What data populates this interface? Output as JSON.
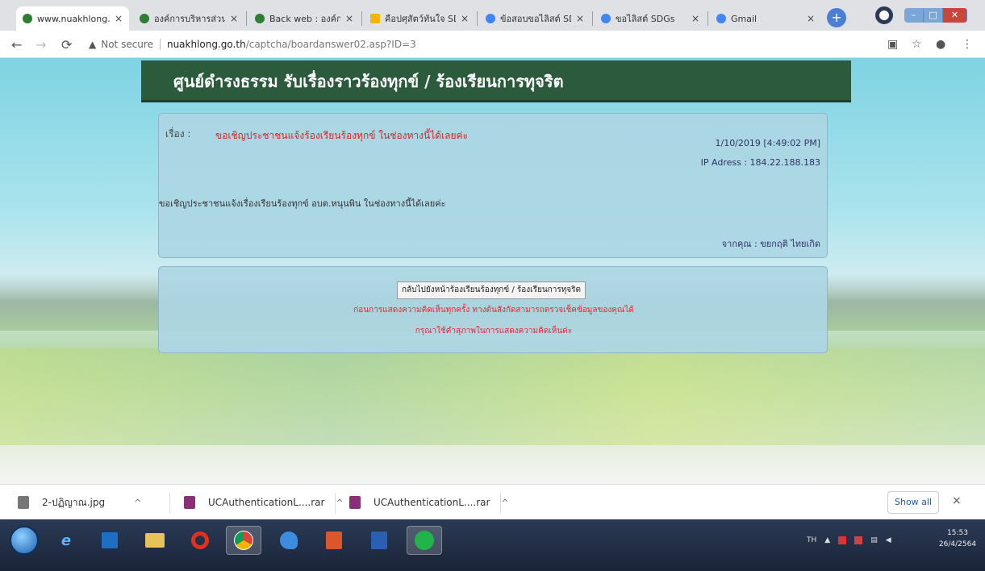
{
  "browser": {
    "tabs": [
      {
        "label": "www.nuakhlong.go",
        "color": "#2e7d32",
        "active": true
      },
      {
        "label": "องค์การบริหารส่วนต",
        "color": "#2e7d32",
        "active": false
      },
      {
        "label": "Back web : องค์การ",
        "color": "#2e7d32",
        "active": false
      },
      {
        "label": "คือปศุสัตว์ทันใจ SDGs",
        "color": "#f4b400",
        "active": false
      },
      {
        "label": "ข้อสอบขอไลิสต์ SDGs",
        "color": "#4285f4",
        "active": false
      },
      {
        "label": "ขอไลิสต์ SDGs",
        "color": "#4285f4",
        "active": false
      },
      {
        "label": "Gmail",
        "color": "#4285f4",
        "active": false
      }
    ],
    "tab_close": "×",
    "new_tab": "+",
    "address": {
      "security": "Not secure",
      "host": "nuakhlong.go.th",
      "path": "/captcha/boardanswer02.asp?ID=3"
    }
  },
  "page": {
    "banner_title": "ศูนย์ดำรงธรรม รับเรื่องราวร้องทุกข์ / ร้องเรียนการทุจริต",
    "message": {
      "subject_label": "เรื่อง :",
      "subject": "ขอเชิญประชาชนแจ้งร้องเรียนร้องทุกข์ ในช่องทางนี้ได้เลยค่ะ",
      "date": "1/10/2019 [4:49:02 PM]",
      "ip": "IP Adress : 184.22.188.183",
      "body": "ขอเชิญประชาชนแจ้งเรื่องเรียนร้องทุกข์ อบต.หนุนพิน ในช่องทางนี้ได้เลยค่ะ",
      "from": "จากคุณ : ขยกฤติ ไทยเกิด"
    },
    "actions": {
      "back_button": "กลับไปยังหน้าร้องเรียนร้องทุกข์ / ร้องเรียนการทุจริต",
      "note_line1": "ก่อนการแสดงความคิดเห็นทุกครั้ง ทางต้นสังกัดสามารถตรวจเช็คข้อมูลของคุณได้",
      "note_line2": "กรุณาใช้คำสุภาพในการแสดงความคิดเห็นค่ะ"
    }
  },
  "downloads": {
    "items": [
      {
        "name": "2-ปฏิญาณ.jpg",
        "icon_color": "#777777"
      },
      {
        "name": "UCAuthenticationL....rar",
        "icon_color": "#8a2f7a"
      },
      {
        "name": "UCAuthenticationL....rar",
        "icon_color": "#8a2f7a"
      }
    ],
    "chevron": "^",
    "show_all": "Show all",
    "close": "×"
  },
  "taskbar": {
    "apps": [
      "ie-icon",
      "outlook-icon",
      "folder-icon",
      "opera-icon",
      "chrome-icon",
      "edge-icon",
      "calculator-icon",
      "word-icon",
      "line-icon"
    ],
    "lang": "TH",
    "time": "15:53",
    "date": "26/4/2564"
  }
}
